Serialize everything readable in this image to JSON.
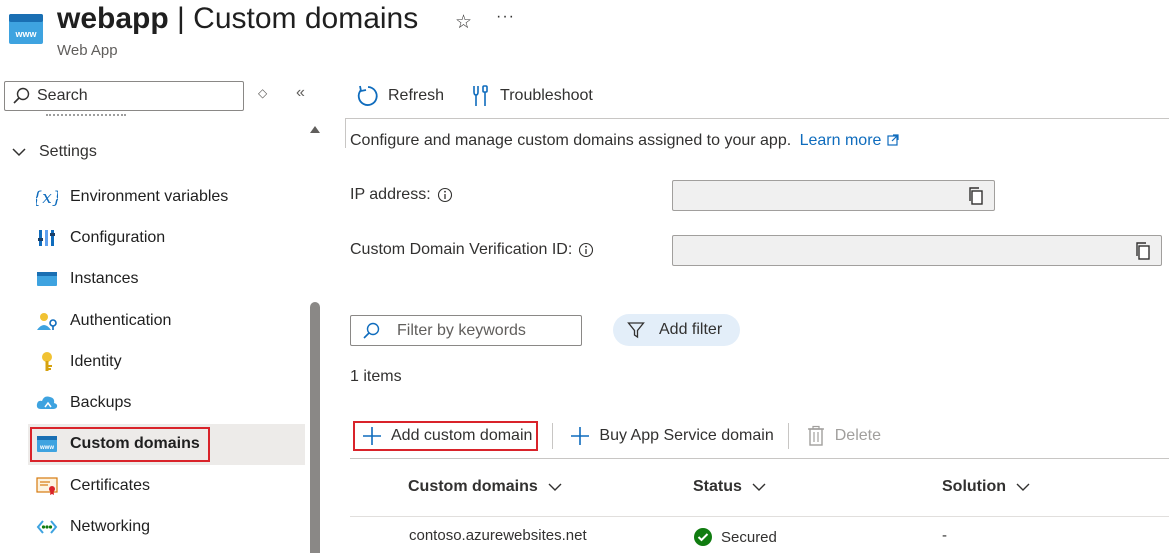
{
  "header": {
    "app_name": "webapp",
    "separator": " | ",
    "page_title": "Custom domains",
    "subtitle": "Web App",
    "icon": "web-app-icon"
  },
  "sidebar": {
    "search_placeholder": "Search",
    "group_label": "Settings",
    "items": [
      {
        "label": "Environment variables",
        "icon": "environment-variables-icon"
      },
      {
        "label": "Configuration",
        "icon": "configuration-icon"
      },
      {
        "label": "Instances",
        "icon": "instances-icon"
      },
      {
        "label": "Authentication",
        "icon": "authentication-icon"
      },
      {
        "label": "Identity",
        "icon": "identity-icon"
      },
      {
        "label": "Backups",
        "icon": "backups-icon"
      },
      {
        "label": "Custom domains",
        "icon": "custom-domains-icon",
        "active": true
      },
      {
        "label": "Certificates",
        "icon": "certificates-icon"
      },
      {
        "label": "Networking",
        "icon": "networking-icon"
      }
    ]
  },
  "toolbar": {
    "refresh_label": "Refresh",
    "troubleshoot_label": "Troubleshoot"
  },
  "main": {
    "description": "Configure and manage custom domains assigned to your app.",
    "learn_more": "Learn more",
    "ip_label": "IP address:",
    "verification_label": "Custom Domain Verification ID:",
    "filter_placeholder": "Filter by keywords",
    "add_filter_label": "Add filter",
    "item_count": "1 items",
    "actions": {
      "add_custom_domain": "Add custom domain",
      "buy_domain": "Buy App Service domain",
      "delete": "Delete"
    },
    "table": {
      "columns": [
        "Custom domains",
        "Status",
        "Solution"
      ],
      "rows": [
        {
          "domain": "contoso.azurewebsites.net",
          "status": "Secured",
          "solution": "-"
        }
      ]
    }
  },
  "colors": {
    "accent": "#0f6cbd",
    "highlight": "#d9232a",
    "success": "#107c10"
  }
}
